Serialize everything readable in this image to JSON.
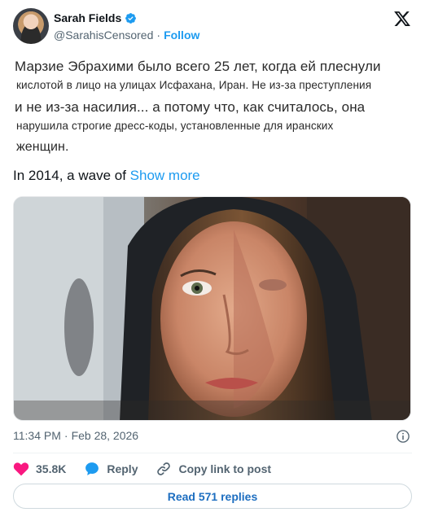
{
  "author": {
    "name": "Sarah Fields",
    "handle": "@SarahisCensored",
    "separator": "·",
    "follow_label": "Follow"
  },
  "quoted_text_lines": [
    "Марзие Эбрахими было всего 25 лет, когда ей плеснули",
    "кислотой в лицо на улицах Исфахана, Иран. Не из-за преступления",
    "и не из-за насилия... а потому что, как считалось, она",
    "нарушила строгие дресс-коды, установленные для иранских",
    "женщин."
  ],
  "tweet": {
    "text": "In 2014, a wave of ",
    "show_more": "Show more"
  },
  "meta": {
    "time": "11:34 PM",
    "separator": "·",
    "date": "Feb 28, 2026"
  },
  "actions": {
    "likes": "35.8K",
    "reply_label": "Reply",
    "copy_link_label": "Copy link to post"
  },
  "read_replies_label": "Read 571 replies",
  "icons": {
    "logo": "x-logo-icon",
    "verified": "verified-badge-icon",
    "info": "info-icon",
    "like": "heart-icon",
    "reply": "reply-bubble-icon",
    "copy": "link-icon"
  },
  "colors": {
    "accent": "#1d9bf0",
    "like": "#f91880",
    "text": "#0f1419",
    "secondary": "#536471"
  }
}
